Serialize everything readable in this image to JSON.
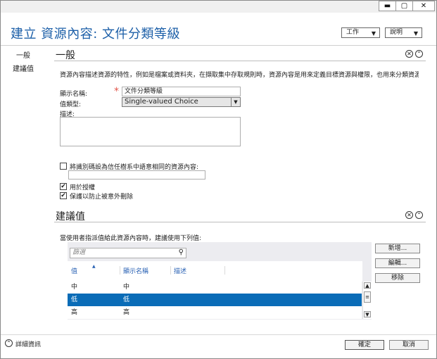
{
  "window": {
    "minimize_label": "▬",
    "restore_label": "▢",
    "close_label": "✕"
  },
  "header": {
    "title": "建立 資源內容: 文件分類等級",
    "task_dropdown": "工作",
    "help_dropdown": "說明"
  },
  "sidebar": {
    "items": [
      {
        "label": "一般"
      },
      {
        "label": "建議值"
      }
    ]
  },
  "general": {
    "title": "一般",
    "description": "資源內容描述資源的特性，例如是檔案或資料夾，在擷取集中存取規則時，資源內容是用來定義目標資源與權限，也用來分類資源。",
    "display_name_label": "顯示名稱:",
    "required_mark": "*",
    "display_name_value": "文件分類等級",
    "value_type_label": "值類型:",
    "value_type_value": "Single-valued Choice",
    "description_label": "描述:",
    "description_value": "",
    "share_checkbox_label": "將識別碼設為信任樹系中語意相同的資源內容:",
    "share_checkbox_checked": false,
    "share_input_value": "",
    "used_for_auth_label": "用於授權",
    "used_for_auth_checked": true,
    "protect_label": "保護以防止被意外刪除",
    "protect_checked": true
  },
  "suggested": {
    "title": "建議值",
    "instruction": "當使用者指派值給此資源內容時，建議使用下列值:",
    "filter_placeholder": "篩選",
    "columns": [
      "值",
      "顯示名稱",
      "描述"
    ],
    "rows": [
      {
        "value": "中",
        "display": "中",
        "desc": ""
      },
      {
        "value": "低",
        "display": "低",
        "desc": ""
      },
      {
        "value": "高",
        "display": "高",
        "desc": ""
      }
    ],
    "selected_index": 1,
    "add_button": "新增...",
    "edit_button": "編輯...",
    "remove_button": "移除"
  },
  "footer": {
    "more_info": "詳細資訊",
    "ok_button": "確定",
    "cancel_button": "取消"
  },
  "colors": {
    "title_blue": "#1c5fa8",
    "selection_blue": "#0a6cb7",
    "required_red": "#e2574c"
  }
}
